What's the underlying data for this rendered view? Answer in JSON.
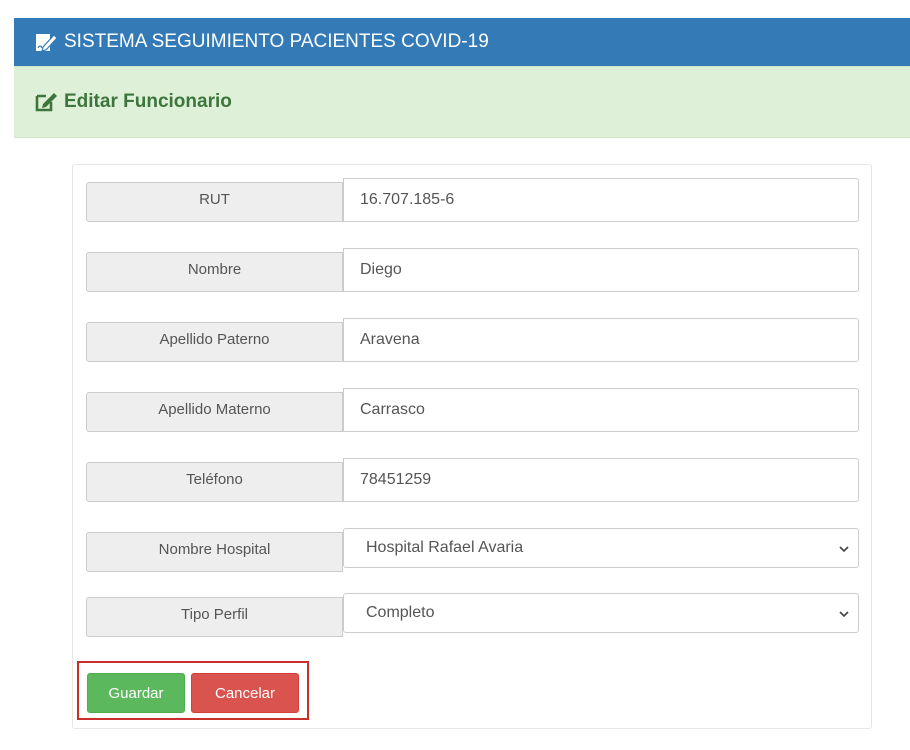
{
  "header": {
    "title": "SISTEMA SEGUIMIENTO PACIENTES COVID-19",
    "icon": "edit-document-icon",
    "color": "#337ab7"
  },
  "subheader": {
    "title": "Editar Funcionario",
    "icon": "external-edit-icon",
    "color": "#3c763d",
    "background": "#dff0d8"
  },
  "form": {
    "fields": [
      {
        "label": "RUT",
        "value": "16.707.185-6"
      },
      {
        "label": "Nombre",
        "value": "Diego"
      },
      {
        "label": "Apellido Paterno",
        "value": "Aravena"
      },
      {
        "label": "Apellido Materno",
        "value": "Carrasco"
      },
      {
        "label": "Teléfono",
        "value": "78451259"
      }
    ],
    "selects": [
      {
        "label": "Nombre Hospital",
        "value": "Hospital Rafael Avaria"
      },
      {
        "label": "Tipo Perfil",
        "value": "Completo"
      }
    ]
  },
  "actions": {
    "save_label": "Guardar",
    "cancel_label": "Cancelar",
    "save_color": "#5cb85c",
    "cancel_color": "#d9534f",
    "highlight_color": "#c9302c"
  }
}
